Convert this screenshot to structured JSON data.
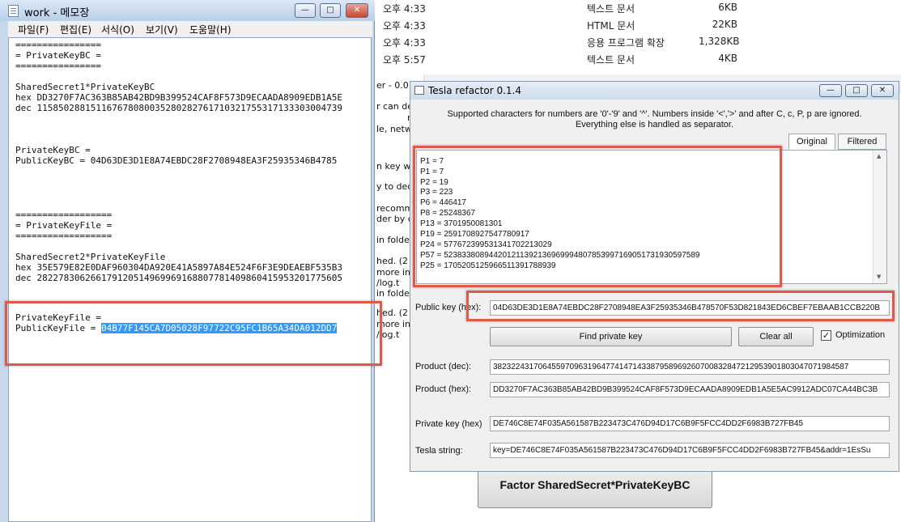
{
  "explorer": {
    "rows": [
      {
        "time": "오후 4:33",
        "type": "텍스트 문서",
        "size": "6KB"
      },
      {
        "time": "오후 4:33",
        "type": "HTML 문서",
        "size": "22KB"
      },
      {
        "time": "오후 4:33",
        "type": "응용 프로그램 확장",
        "size": "1,328KB"
      },
      {
        "time": "오후 5:57",
        "type": "텍스트 문서",
        "size": "4KB"
      }
    ],
    "fragments": [
      "er - 0.0",
      "r can de",
      "r",
      "le, netw",
      "n key wa",
      "y to dec",
      "recomm",
      "der by c",
      "in folde",
      "hed. (2",
      "more inf",
      "/log.t",
      "in folde",
      "hed. (2",
      "more inf",
      "/log.t"
    ],
    "factor_button": "Factor SharedSecret*PrivateKeyBC"
  },
  "notepad": {
    "title": "work - 메모장",
    "menu": [
      "파일(F)",
      "편집(E)",
      "서식(O)",
      "보기(V)",
      "도움말(H)"
    ],
    "lines": [
      "================",
      "= PrivateKeyBC =",
      "================",
      "",
      "SharedSecret1*PrivateKeyBC",
      "hex DD3270F7AC363B85AB42BD9B399524CAF8F573D9ECAADA8909EDB1A5E",
      "dec 115850288151167678080035280282761710321755317133303004739",
      "",
      "",
      "",
      "PrivateKeyBC =",
      "PublicKeyBC = 04D63DE3D1E8A74EBDC28F2708948EA3F25935346B4785",
      "",
      "",
      "",
      "==================",
      "= PrivateKeyFile =",
      "==================",
      "",
      "SharedSecret2*PrivateKeyFile",
      "hex 35E579E82E0DAF960304DA920E41A5897A84E524F6F3E9DEAEBF535B3",
      "dec 282278306266179120514969969168807781409860415953201775605",
      "",
      "",
      "",
      "PrivateKeyFile =",
      "PublicKeyFile = "
    ],
    "selected": "04B77F145CA7D05028F97722C95FC1B65A34DA012DD7"
  },
  "dialog": {
    "title": "Tesla refactor 0.1.4",
    "info_line1": "Supported characters for numbers are '0'-'9' and '^'. Numbers inside '<','>' and after C, c, P, p are ignored.",
    "info_line2": "Everything else is handled as separator.",
    "tabs": [
      "Original",
      "Filtered"
    ],
    "primes": [
      "P1 = 7",
      "P1 = 7",
      "P2 = 19",
      "P3 = 223",
      "P6 = 446417",
      "P8 = 25248367",
      "P13 = 3701950081301",
      "P19 = 2591708927547780917",
      "P24 = 577672399531341702213029",
      "P57 = 523833808944201211392136969994807853997169051731930597589",
      "P25 = 1705205125966511391788939"
    ],
    "public_key_label": "Public key (hex):",
    "public_key_value": "04D63DE3D1E8A74EBDC28F2708948EA3F25935346B478570F53D821843ED6CBEF7EBAAB1CCB220B",
    "find_button": "Find private key",
    "clear_button": "Clear all",
    "optimization_label": "Optimization",
    "optimization_checked": "✓",
    "product_dec_label": "Product (dec):",
    "product_dec_value": "3823224317064559709631964774147143387958969260700832847212953901803047071984587",
    "product_hex_label": "Product (hex):",
    "product_hex_value": "DD3270F7AC363B85AB42BD9B399524CAF8F573D9ECAADA8909EDB1A5E5AC9912ADC07CA44BC3B",
    "private_key_label": "Private key (hex)",
    "private_key_value": "DE746C8E74F035A561587B223473C476D94D17C6B9F5FCC4DD2F6983B727FB45",
    "tesla_string_label": "Tesla string:",
    "tesla_string_value": "key=DE746C8E74F035A561587B223473C476D94D17C6B9F5FCC4DD2F6983B727FB45&addr=1EsSu"
  },
  "colors": {
    "annotation_red": "#e05a4a",
    "selection_blue": "#3399ff"
  }
}
